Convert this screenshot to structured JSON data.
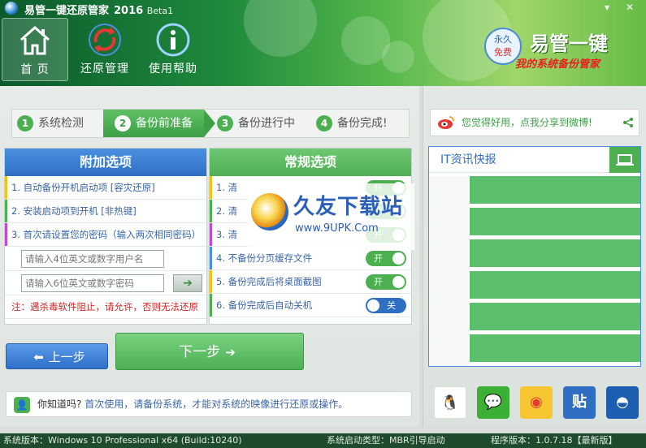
{
  "window": {
    "title": "易管一键还原管家",
    "version": "2016",
    "beta": "Beta1",
    "min_glyph": "▾",
    "close_glyph": "✕"
  },
  "nav": [
    {
      "label": "首 页",
      "icon": "home-icon",
      "active": true
    },
    {
      "label": "还原管理",
      "icon": "restore-icon",
      "active": false
    },
    {
      "label": "使用帮助",
      "icon": "info-icon",
      "active": false
    }
  ],
  "brand": {
    "seal_top": "永久",
    "seal_bottom": "免费",
    "name": "易管一键",
    "slogan": "我的系统备份管家"
  },
  "steps": [
    {
      "num": "1",
      "label": "系统检测"
    },
    {
      "num": "2",
      "label": "备份前准备"
    },
    {
      "num": "3",
      "label": "备份进行中"
    },
    {
      "num": "4",
      "label": "备份完成!"
    }
  ],
  "extra_options": {
    "title": "附加选项",
    "items": [
      "1. 自动备份开机启动项 [容灾还原]",
      "2. 安装启动项到开机 [非热键]",
      "3. 首次请设置您的密码（输入两次相同密码）"
    ],
    "username_placeholder": "请输入4位英文或数字用户名",
    "password_placeholder": "请输入6位英文或数字密码",
    "go_glyph": "➔",
    "warning": "注：遇杀毒软件阻止，请允许，否则无法还原"
  },
  "general_options": {
    "title": "常规选项",
    "items": [
      {
        "label": "1. 清",
        "toggle": "开"
      },
      {
        "label": "2. 清",
        "toggle": "开"
      },
      {
        "label": "3. 清",
        "toggle": "开"
      },
      {
        "label": "4. 不备份分页缓存文件",
        "toggle": "开"
      },
      {
        "label": "5. 备份完成后将桌面截图",
        "toggle": "开"
      },
      {
        "label": "6. 备份完成后自动关机",
        "toggle": "关"
      }
    ]
  },
  "buttons": {
    "prev": "上一步",
    "next": "下一步",
    "prev_arrow": "⬅",
    "next_arrow": "➔"
  },
  "tip": {
    "icon_glyph": "👤",
    "question": "你知道吗?",
    "message": "首次使用，请备份系统，才能对系统的映像进行还原或操作。"
  },
  "share": {
    "text": "您觉得好用，点我分享到微博!"
  },
  "news": {
    "title": "IT资讯快报",
    "rows": 6
  },
  "social": [
    {
      "icon": "qq-icon",
      "glyph": "🐧",
      "color": "#ffffff"
    },
    {
      "icon": "wechat-icon",
      "glyph": "💬",
      "color": "#3cb034"
    },
    {
      "icon": "weibo-icon",
      "glyph": "◉",
      "color": "#f7c531"
    },
    {
      "icon": "tieba-icon",
      "glyph": "贴",
      "color": "#2f6fc3"
    },
    {
      "icon": "baidu-cloud-icon",
      "glyph": "◓",
      "color": "#1c5fb0"
    }
  ],
  "status": {
    "os": "系统版本：Windows 10 Professional x64 (Build:10240)",
    "boot": "系统启动类型：MBR引导启动",
    "app_version": "程序版本：1.0.7.18【最新版】"
  },
  "watermark": {
    "title": "久友下载站",
    "url": "www.9UPK.Com",
    "overlap": "9U"
  }
}
